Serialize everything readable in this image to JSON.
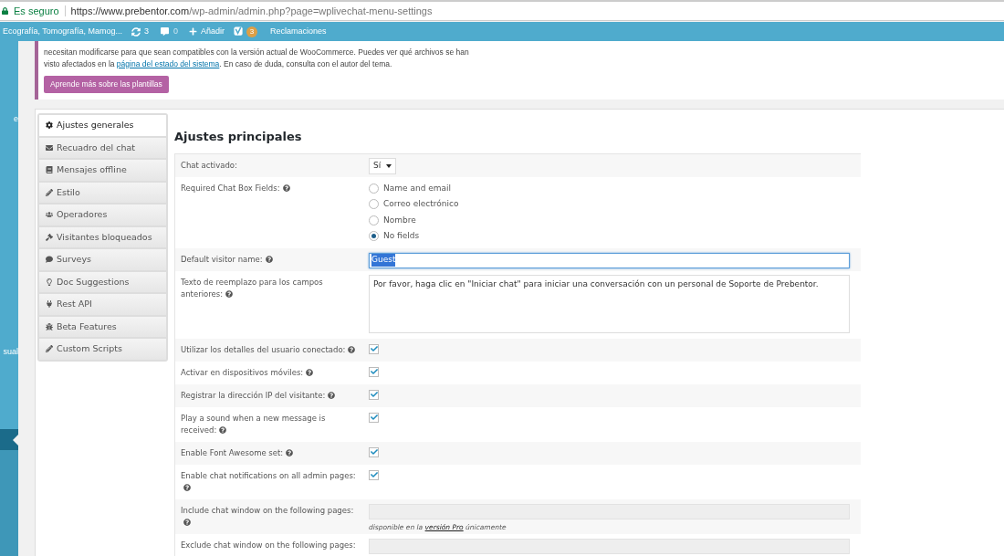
{
  "address_bar": {
    "security": "Es seguro",
    "url_host": "https://www.prebentor.com",
    "url_path": "/wp-admin/admin.php?page=wplivechat-menu-settings"
  },
  "admin_bar": {
    "site": "Ecografía, Tomografía, Mamog...",
    "updates": "3",
    "comments": "0",
    "new": "Añadir",
    "seo_badge": "3",
    "link": "Reclamaciones"
  },
  "admin_menu": {
    "fragments": [
      "e",
      "sual"
    ]
  },
  "notice": {
    "text_before": "necesitan modificarse para que sean compatibles con la versión actual de WooCommerce. Puedes ver qué archivos se han visto afectados en la ",
    "link": "página del estado del sistema",
    "text_after": ". En caso de duda, consulta con el autor del tema.",
    "button": "Aprende más sobre las plantillas"
  },
  "tabs": [
    {
      "label": "Ajustes generales",
      "selected": true
    },
    {
      "label": "Recuadro del chat",
      "selected": false
    },
    {
      "label": "Mensajes offline",
      "selected": false
    },
    {
      "label": "Estilo",
      "selected": false
    },
    {
      "label": "Operadores",
      "selected": false
    },
    {
      "label": "Visitantes bloqueados",
      "selected": false
    },
    {
      "label": "Surveys",
      "selected": false
    },
    {
      "label": "Doc Suggestions",
      "selected": false
    },
    {
      "label": "Rest API",
      "selected": false
    },
    {
      "label": "Beta Features",
      "selected": false
    },
    {
      "label": "Custom Scripts",
      "selected": false
    }
  ],
  "heading": "Ajustes principales",
  "rows": [
    {
      "kind": "select",
      "label": "Chat activado:",
      "help": false,
      "value": "Sí"
    },
    {
      "kind": "radio",
      "label": "Required Chat Box Fields:",
      "help": true,
      "options": [
        {
          "label": "Name and email",
          "selected": false
        },
        {
          "label": "Correo electrónico",
          "selected": false
        },
        {
          "label": "Nombre",
          "selected": false
        },
        {
          "label": "No fields",
          "selected": true
        }
      ]
    },
    {
      "kind": "text",
      "label": "Default visitor name:",
      "help": true,
      "value": "Guest",
      "focused": true
    },
    {
      "kind": "textarea",
      "label": "Texto de reemplazo para los campos anteriores:",
      "help": true,
      "value": "Por favor, haga clic en \"Iniciar chat\" para iniciar una conversación con un personal de Soporte de Prebentor."
    },
    {
      "kind": "checkbox",
      "label": "Utilizar los detalles del usuario conectado:",
      "help": true,
      "checked": true
    },
    {
      "kind": "checkbox",
      "label": "Activar en dispositivos móviles:",
      "help": true,
      "checked": true
    },
    {
      "kind": "checkbox",
      "label": "Registrar la dirección IP del visitante:",
      "help": true,
      "checked": true
    },
    {
      "kind": "checkbox",
      "label": "Play a sound when a new message is received:",
      "help": true,
      "checked": true
    },
    {
      "kind": "checkbox",
      "label": "Enable Font Awesome set:",
      "help": true,
      "checked": true
    },
    {
      "kind": "checkbox",
      "label": "Enable chat notifications on all admin pages:",
      "help": true,
      "checked": true
    },
    {
      "kind": "disabled",
      "label": "Include chat window on the following pages:",
      "help": true,
      "note_before": "disponible en la ",
      "note_link": "versión Pro",
      "note_after": " únicamente"
    },
    {
      "kind": "disabled",
      "label": "Exclude chat window on the following pages:",
      "help": false
    }
  ]
}
